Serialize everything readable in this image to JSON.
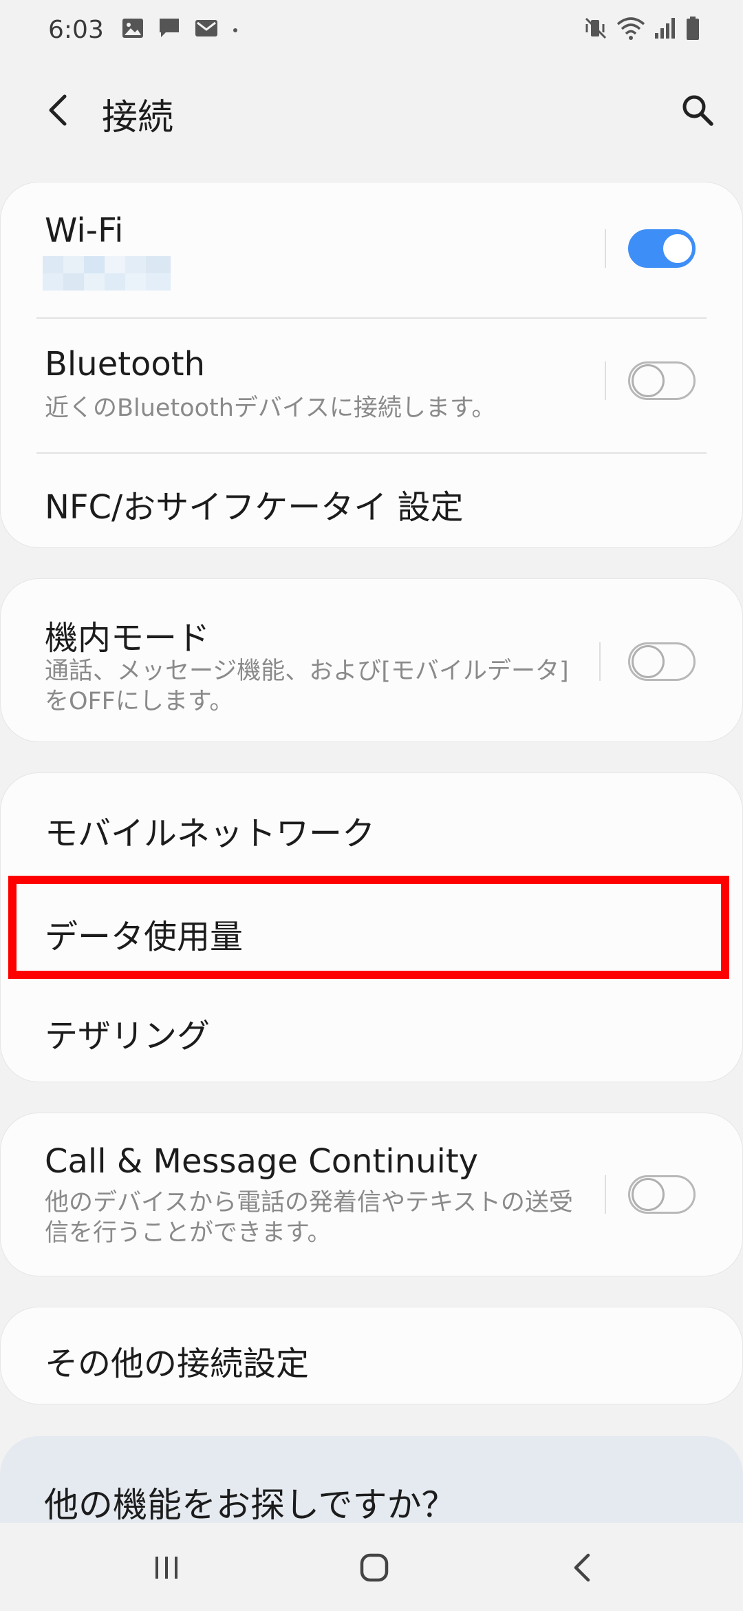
{
  "status_bar": {
    "time": "6:03",
    "left_icons": [
      "gallery-icon",
      "chat-icon",
      "gmail-icon",
      "dot-icon"
    ],
    "right_icons": [
      "vibrate-mute-icon",
      "wifi-icon",
      "signal-icon",
      "battery-icon"
    ]
  },
  "header": {
    "title": "接続",
    "back_icon": "chevron-left-icon",
    "search_icon": "search-icon"
  },
  "cards": {
    "wifi": {
      "title": "Wi-Fi",
      "enabled": true
    },
    "bluetooth": {
      "title": "Bluetooth",
      "subtitle": "近くのBluetoothデバイスに接続します。",
      "enabled": false
    },
    "nfc": {
      "title": "NFC/おサイフケータイ 設定"
    },
    "airplane": {
      "title": "機内モード",
      "subtitle": "通話、メッセージ機能、および[モバイルデータ]をOFFにします。",
      "enabled": false
    },
    "mobile_network": {
      "title": "モバイルネットワーク"
    },
    "data_usage": {
      "title": "データ使用量"
    },
    "tethering": {
      "title": "テザリング"
    },
    "call_message": {
      "title": "Call & Message Continuity",
      "subtitle": "他のデバイスから電話の発着信やテキストの送受信を行うことができます。",
      "enabled": false
    },
    "other_settings": {
      "title": "その他の接続設定"
    },
    "looking_for": {
      "title": "他の機能をお探しですか？"
    }
  },
  "navbar": {
    "recents_icon": "recents-icon",
    "home_icon": "home-icon",
    "back_icon": "back-icon"
  },
  "colors": {
    "accent": "#3e8ef7",
    "highlight": "#ff0000",
    "background": "#f2f2f2"
  }
}
